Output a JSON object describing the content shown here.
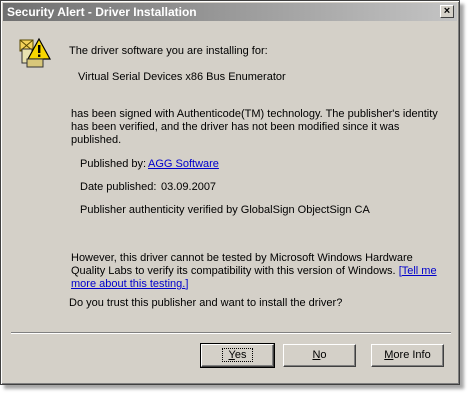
{
  "window": {
    "title": "Security Alert - Driver Installation",
    "close_glyph": "×"
  },
  "intro": "The driver software you are installing for:",
  "device": "Virtual Serial Devices x86 Bus Enumerator",
  "signed_text": "has been signed with Authenticode(TM) technology. The publisher's identity has been verified, and the driver has not been modified since it was published.",
  "details": {
    "published_by_label": "Published by:",
    "publisher": "AGG Software",
    "date_label": "Date published:",
    "date": "03.09.2007",
    "authenticity": "Publisher authenticity verified by GlobalSign ObjectSign CA"
  },
  "warning": {
    "text": "However, this driver cannot be tested by Microsoft Windows Hardware Quality Labs to verify its compatibility with this version of Windows. ",
    "link_open": "[",
    "link": "Tell me more about this testing.",
    "link_close": "]"
  },
  "question": "Do you trust this publisher and want to install the driver?",
  "buttons": {
    "yes_first": "Y",
    "yes_rest": "es",
    "no_first": "N",
    "no_rest": "o",
    "more_first": "M",
    "more_rest": "ore Info"
  },
  "colors": {
    "link": "#0000cc",
    "dialog": "#d4d0c8",
    "titlebar_inactive": "#6f6f6f"
  },
  "icons": {
    "main": "shield-warning-icon"
  }
}
